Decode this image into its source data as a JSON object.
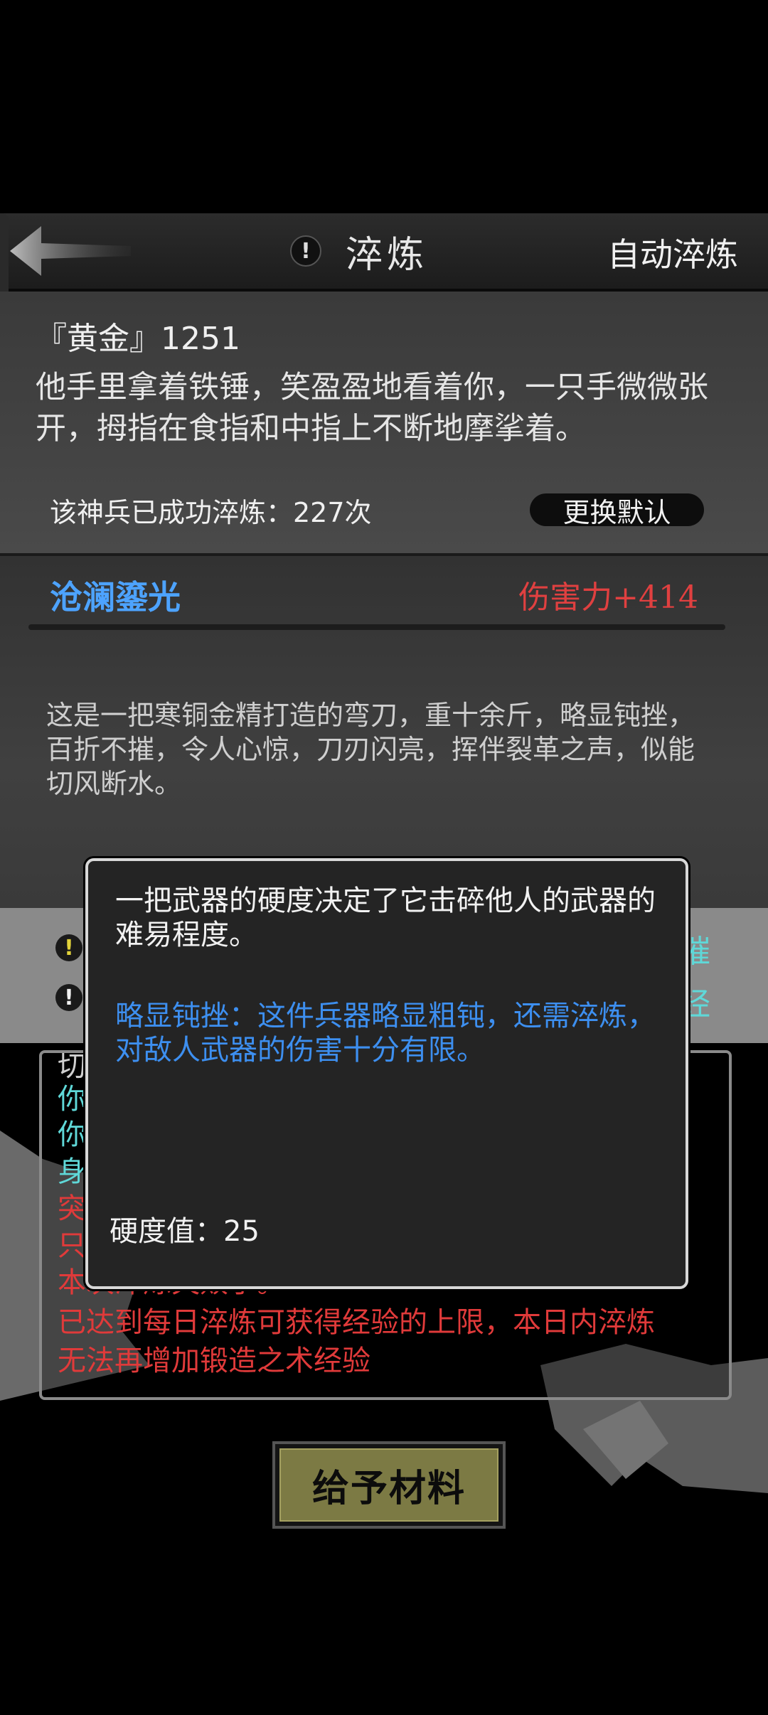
{
  "header": {
    "title": "淬炼",
    "title_icon": "!",
    "auto_button": "自动淬炼",
    "back_icon": "back-arrow-icon"
  },
  "weapon": {
    "name": "『黄金』1251",
    "description": "他手里拿着铁锤，笑盈盈地看着你，一只手微微张开，拇指在食指和中指上不断地摩挲着。",
    "refine_count": "该神兵已成功淬炼：227次",
    "change_default": "更换默认"
  },
  "skill": {
    "name": "沧澜鎏光",
    "damage": "伤害力+414",
    "description": "这是一把寒铜金精打造的弯刀，重十余斤，略显钝挫，百折不摧，令人心惊，刀刃闪亮，挥伴裂革之声，似能切风断水。"
  },
  "partial_right": [
    "摧",
    "经"
  ],
  "log": {
    "lines": [
      {
        "text": "切",
        "color": "#cfcfcf"
      },
      {
        "text": "你",
        "color": "#5fd8d8"
      },
      {
        "text": "你",
        "color": "#5fd8d8"
      },
      {
        "text": "身",
        "color": "#5fd8d8"
      },
      {
        "text": "突",
        "color": "#e03a3a"
      },
      {
        "text": "只",
        "color": "#e03a3a"
      },
      {
        "text": "本次淬炼失败了。",
        "color": "#e03a3a"
      },
      {
        "text": "已达到每日淬炼可获得经验的上限，本日内淬炼",
        "color": "#e03a3a"
      },
      {
        "text": "无法再增加锻造之术经验",
        "color": "#e03a3a"
      }
    ]
  },
  "tooltip": {
    "intro": "一把武器的硬度决定了它击碎他人的武器的难易程度。",
    "detail": "略显钝挫：这件兵器略显粗钝，还需淬炼，对敌人武器的伤害十分有限。",
    "hardness": "硬度值：25"
  },
  "give_button": "给予材料",
  "colors": {
    "skill_name": "#4da3ff",
    "damage": "#e04040",
    "log_warning": "#e03a3a",
    "log_info": "#5fd8d8",
    "tooltip_detail": "#3d8ff0",
    "button": "#7c7a44"
  }
}
